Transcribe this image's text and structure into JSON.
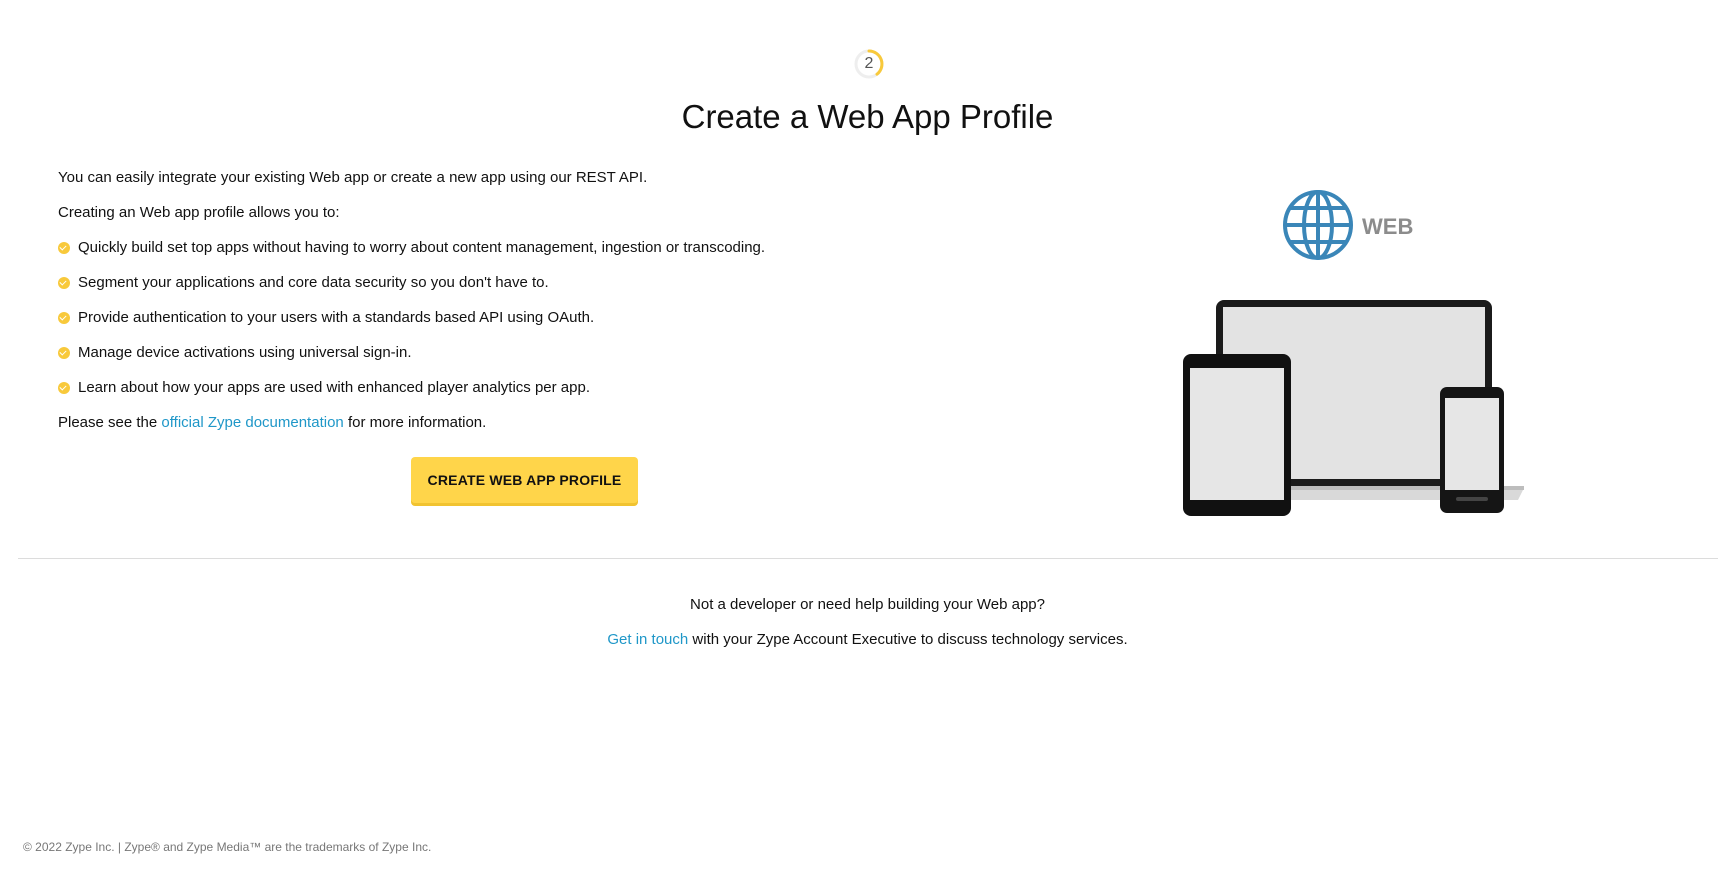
{
  "step": {
    "number": "2",
    "accent_color": "#f8c93b"
  },
  "title": "Create a Web App Profile",
  "intro": {
    "line1": "You can easily integrate your existing Web app or create a new app using our REST API.",
    "line2": "Creating an Web app profile allows you to:"
  },
  "bullets": [
    "Quickly build set top apps without having to worry about content management, ingestion or transcoding.",
    "Segment your applications and core data security so you don't have to.",
    "Provide authentication to your users with a standards based API using OAuth.",
    "Manage device activations using universal sign-in.",
    "Learn about how your apps are used with enhanced player analytics per app."
  ],
  "docs": {
    "prefix": "Please see the",
    "link_text": "official Zype documentation",
    "suffix": "for more information."
  },
  "cta": {
    "label": "CREATE WEB APP PROFILE",
    "color": "#ffd54a"
  },
  "illustration": {
    "badge_label": "WEB",
    "globe_color": "#3a86b8",
    "icon": "globe-icon"
  },
  "help": {
    "question": "Not a developer or need help building your Web app?",
    "link_text": "Get in touch",
    "suffix": "with your Zype Account Executive to discuss technology services."
  },
  "footer": "© 2022 Zype Inc. | Zype® and Zype Media™ are the trademarks of Zype Inc.",
  "colors": {
    "link": "#1f97c8",
    "check": "#f8c93b"
  }
}
